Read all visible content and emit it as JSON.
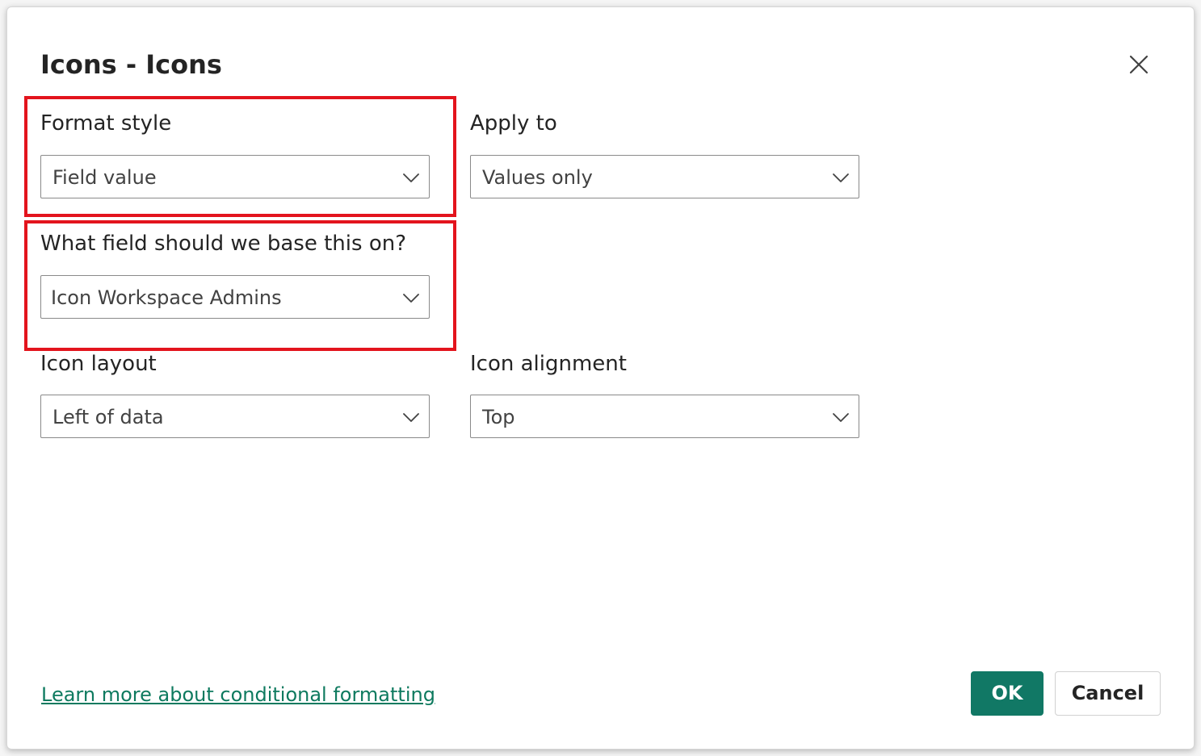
{
  "dialog": {
    "title": "Icons - Icons"
  },
  "fields": {
    "format_style": {
      "label": "Format style",
      "value": "Field value"
    },
    "apply_to": {
      "label": "Apply to",
      "value": "Values only"
    },
    "base_field": {
      "label": "What field should we base this on?",
      "value": "Icon Workspace Admins"
    },
    "icon_layout": {
      "label": "Icon layout",
      "value": "Left of data"
    },
    "icon_alignment": {
      "label": "Icon alignment",
      "value": "Top"
    }
  },
  "footer": {
    "learn_more": "Learn more about conditional formatting",
    "ok_label": "OK",
    "cancel_label": "Cancel"
  },
  "colors": {
    "primary": "#117865",
    "link": "#0e7a5f",
    "highlight": "#e3141d"
  }
}
